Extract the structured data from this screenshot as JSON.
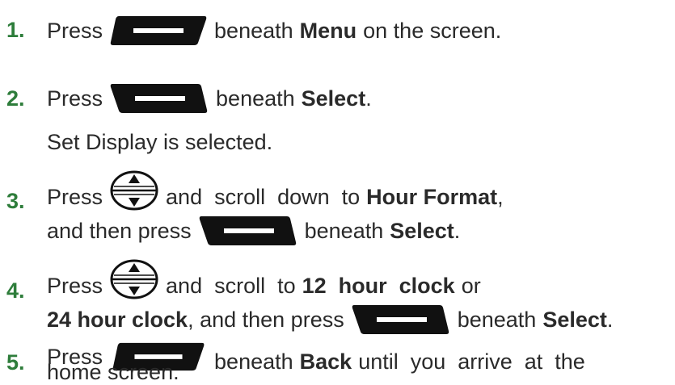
{
  "steps": [
    {
      "number": "1.",
      "lines": [
        {
          "t1": "Press",
          "t2": "beneath",
          "bold1": "Menu",
          "t3": "on the screen."
        }
      ]
    },
    {
      "number": "2.",
      "lines": [
        {
          "t1": "Press",
          "t2": "beneath",
          "bold1": "Select",
          "t3": "."
        },
        {
          "t1": "Set Display is selected."
        }
      ]
    },
    {
      "number": "3.",
      "lines": [
        {
          "t1": "Press",
          "t2": "and  scroll  down  to",
          "bold1": "Hour Format",
          "t3": ","
        },
        {
          "t1": "and then press",
          "t2": "beneath",
          "bold1": "Select",
          "t3": "."
        }
      ]
    },
    {
      "number": "4.",
      "lines": [
        {
          "t1": "Press",
          "t2": "and  scroll  to",
          "bold1": "12  hour  clock",
          "t3": "or"
        },
        {
          "bold0": "24 hour clock",
          "t1": ", and then press",
          "t2": "beneath",
          "bold1": "Select",
          "t3": "."
        }
      ]
    },
    {
      "number": "5.",
      "lines": [
        {
          "t1": "Press",
          "t2": "beneath",
          "bold1": "Back",
          "t3": "until  you  arrive  at  the"
        },
        {
          "t1": "home screen."
        }
      ]
    }
  ],
  "icons": {
    "left_softkey": "left-softkey-icon",
    "right_softkey": "right-softkey-icon",
    "nav_key": "navigation-key-icon"
  },
  "colors": {
    "step_number": "#2e7d3b",
    "text": "#2a2a2a"
  }
}
